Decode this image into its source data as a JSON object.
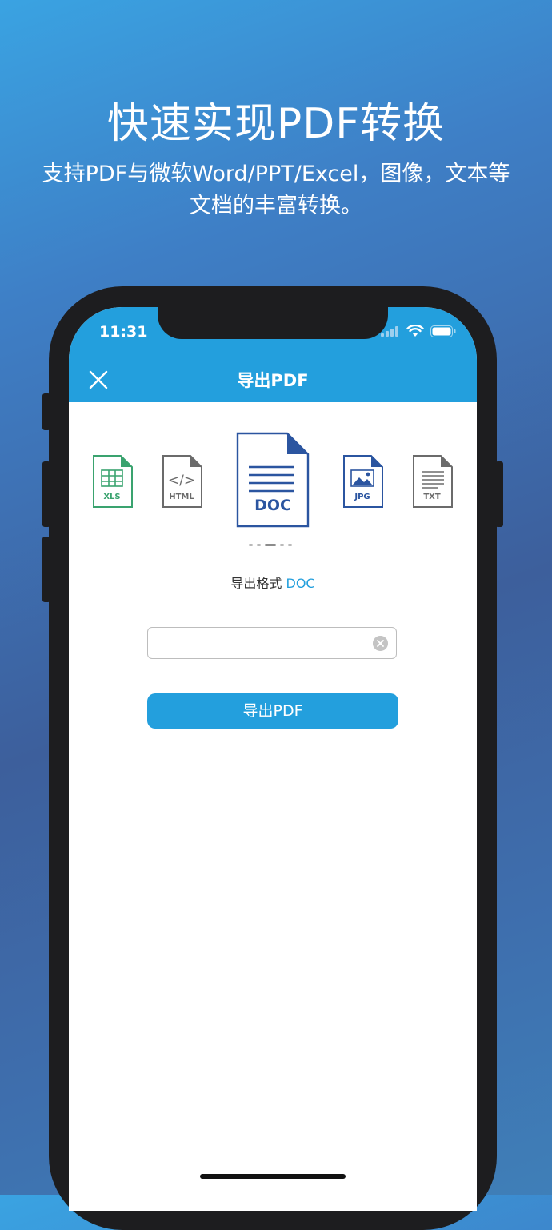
{
  "promo": {
    "title": "快速实现PDF转换",
    "subtitle_line1": "支持PDF与微软Word/PPT/Excel，图像，文本等",
    "subtitle_line2": "文档的丰富转换。"
  },
  "status_bar": {
    "time": "11:31"
  },
  "nav": {
    "title": "导出PDF"
  },
  "formats": [
    {
      "label": "XLS",
      "color": "#3aa36f"
    },
    {
      "label": "HTML",
      "color": "#6b6b6b"
    },
    {
      "label": "DOC",
      "color": "#2b55a0"
    },
    {
      "label": "JPG",
      "color": "#2b55a0"
    },
    {
      "label": "TXT",
      "color": "#6b6b6b"
    }
  ],
  "export": {
    "format_label": "导出格式",
    "format_value": "DOC",
    "filename_value": "",
    "button_label": "导出PDF"
  },
  "colors": {
    "accent": "#239fdd",
    "phone": "#1d1d1f"
  }
}
